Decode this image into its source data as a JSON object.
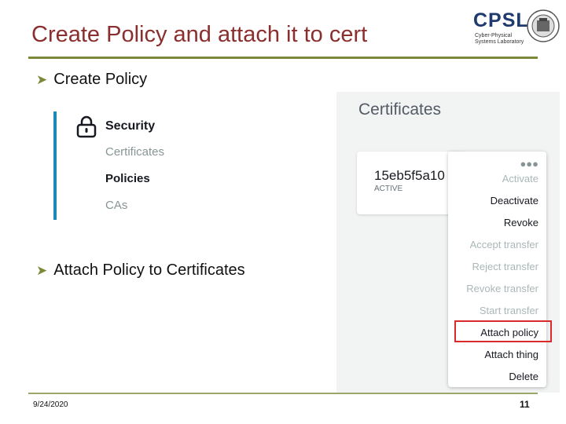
{
  "slide": {
    "title": "Create Policy and attach it to cert",
    "bullets": [
      "Create Policy",
      "Attach Policy to Certificates"
    ],
    "footer_date": "9/24/2020",
    "page_number": "11",
    "accent_color": "#8b2e2e",
    "rule_color": "#7a8a3a"
  },
  "logo": {
    "text": "CPSL",
    "subtitle_line1": "Cyber-Physical",
    "subtitle_line2": "Systems Laboratory"
  },
  "nav_panel": {
    "icon": "lock-icon",
    "heading": "Security",
    "items": [
      "Certificates",
      "Policies",
      "CAs"
    ],
    "active_item": "Policies",
    "accent_color": "#1c8ab8"
  },
  "certificates_panel": {
    "title": "Certificates",
    "certificate": {
      "id": "15eb5f5a10",
      "status": "ACTIVE"
    },
    "menu_icon": "more-options-icon",
    "menu_items": [
      {
        "label": "Activate",
        "enabled": false
      },
      {
        "label": "Deactivate",
        "enabled": true
      },
      {
        "label": "Revoke",
        "enabled": true
      },
      {
        "label": "Accept transfer",
        "enabled": false
      },
      {
        "label": "Reject transfer",
        "enabled": false
      },
      {
        "label": "Revoke transfer",
        "enabled": false
      },
      {
        "label": "Start transfer",
        "enabled": false
      },
      {
        "label": "Attach policy",
        "enabled": true,
        "highlighted": true
      },
      {
        "label": "Attach thing",
        "enabled": true
      },
      {
        "label": "Delete",
        "enabled": true
      }
    ],
    "highlight_color": "#d92b2b"
  }
}
